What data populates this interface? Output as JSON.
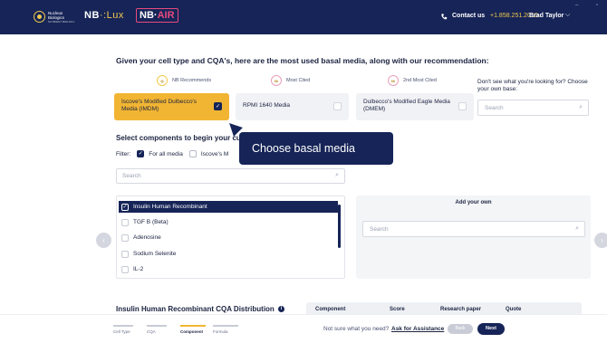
{
  "header": {
    "brand_line1": "Nucleus",
    "brand_line2": "Biologics",
    "brand_line3": "NUTRIENT BIOLOGY",
    "nb_lux_prefix": "NB",
    "nb_lux_suffix": "Lux",
    "nb_air_prefix": "NB",
    "nb_air_suffix": "AIR",
    "contact_label": "Contact us",
    "phone": "+1.858.251.2010",
    "user_name": "Brad Taylor",
    "colors": {
      "header_bg": "#162457",
      "accent_gold": "#f2c94c",
      "accent_pink": "#e84a7f"
    }
  },
  "page": {
    "title": "Given your cell type and CQA's, here are the most used basal media, along with our recommendation:"
  },
  "recommendations": {
    "nb_label": "NB Recommends",
    "most_cited_label": "Most Cited",
    "second_label": "2nd Most Cited",
    "badge_text": "66"
  },
  "media": [
    {
      "label": "Iscove's Modified Dulbecco's Media (IMDM)",
      "selected": true
    },
    {
      "label": "RPMI 1640 Media",
      "selected": false
    },
    {
      "label": "Dulbecco's Modified Eagle Media (DMEM)",
      "selected": false
    }
  ],
  "basal": {
    "prompt": "Don't see what you're looking for? Choose your own base:",
    "search_placeholder": "Search"
  },
  "components": {
    "heading": "Select components to begin your cu",
    "filter_label": "Filter:",
    "filter_all": "For all media",
    "filter_iscove": "Iscove's M",
    "search_placeholder": "Search",
    "items": [
      {
        "label": "Insulin Human Recombinant",
        "checked": true
      },
      {
        "label": "TGF B (Beta)",
        "checked": false
      },
      {
        "label": "Adenosine",
        "checked": false
      },
      {
        "label": "Sodium Selenite",
        "checked": false
      },
      {
        "label": "IL-2",
        "checked": false
      }
    ]
  },
  "add_own": {
    "title": "Add your own",
    "search_placeholder": "Search"
  },
  "tooltip": {
    "text": "Choose basal media"
  },
  "distribution": {
    "title": "Insulin Human Recombinant CQA Distribution",
    "columns": [
      "Component",
      "Score",
      "Research paper",
      "Quote"
    ]
  },
  "footer": {
    "steps": [
      {
        "label": "Cell Type",
        "active": false
      },
      {
        "label": "CQA",
        "active": false
      },
      {
        "label": "Component",
        "active": true
      },
      {
        "label": "Formula",
        "active": false
      }
    ],
    "not_sure": "Not sure what you need?",
    "assist": "Ask for Assistance",
    "back": "Back",
    "next": "Next"
  }
}
